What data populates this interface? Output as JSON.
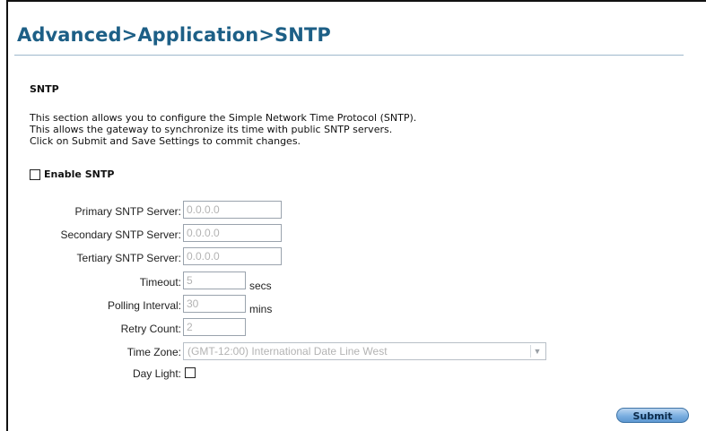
{
  "page": {
    "title": "Advanced>Application>SNTP",
    "section_heading": "SNTP",
    "description": [
      "This section allows you to configure the Simple Network Time Protocol (SNTP).",
      "This allows the gateway to synchronize its time with public SNTP servers.",
      "Click on Submit and Save Settings to commit changes."
    ]
  },
  "enable_sntp": {
    "label": "Enable SNTP",
    "checked": false
  },
  "form": {
    "primary": {
      "label": "Primary SNTP Server:",
      "value": "0.0.0.0"
    },
    "secondary": {
      "label": "Secondary SNTP Server:",
      "value": "0.0.0.0"
    },
    "tertiary": {
      "label": "Tertiary SNTP Server:",
      "value": "0.0.0.0"
    },
    "timeout": {
      "label": "Timeout:",
      "value": "5",
      "unit": "secs"
    },
    "polling": {
      "label": "Polling Interval:",
      "value": "30",
      "unit": "mins"
    },
    "retry": {
      "label": "Retry Count:",
      "value": "2"
    },
    "timezone": {
      "label": "Time Zone:",
      "selected": "(GMT-12:00) International Date Line West"
    },
    "daylight": {
      "label": "Day Light:",
      "checked": false
    }
  },
  "actions": {
    "submit_label": "Submit"
  },
  "colors": {
    "title": "#1d5f86",
    "button": "#7aaee0",
    "disabled_text": "#b3b3b3"
  }
}
